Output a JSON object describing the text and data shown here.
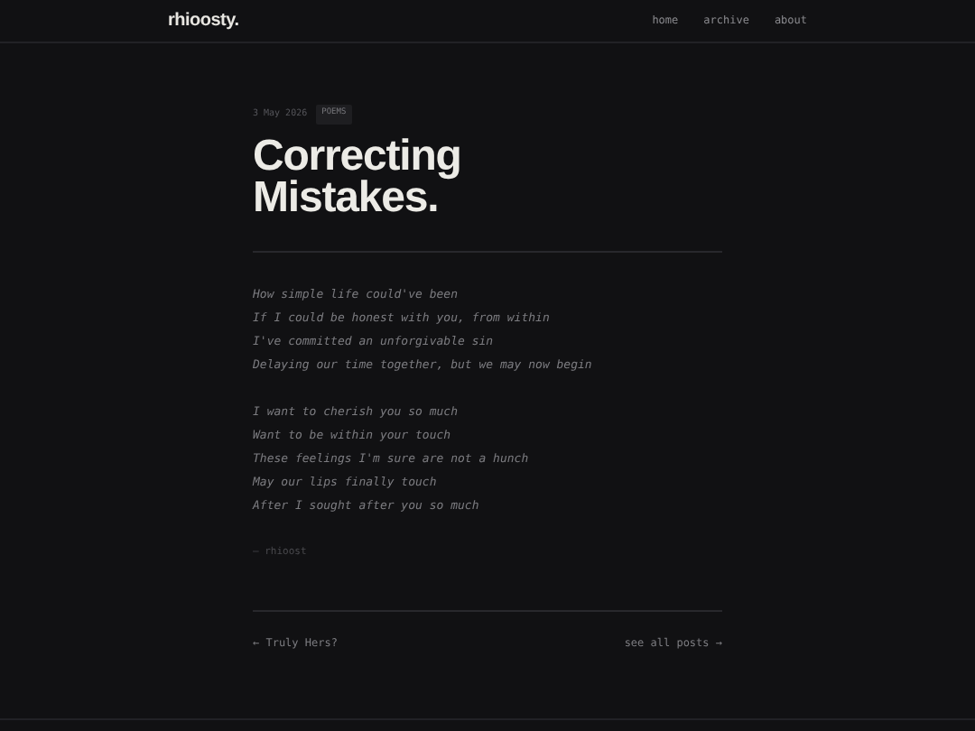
{
  "header": {
    "logo": "rhioosty.",
    "nav": [
      "home",
      "archive",
      "about"
    ]
  },
  "post": {
    "date": "3 May 2026",
    "tag": "POEMS",
    "title_lines": [
      "Correcting",
      "Mistakes."
    ],
    "stanzas": [
      [
        "How simple life could've been",
        "If I could be honest with you, from within",
        "I've committed an unforgivable sin",
        "Delaying our time together, but we may now begin"
      ],
      [
        "I want to cherish you so much",
        "Want to be within your touch",
        "These feelings I'm sure are not a hunch",
        "May our lips finally touch",
        "After I sought after you so much"
      ]
    ],
    "signature": "— rhioost"
  },
  "post_nav": {
    "previous": "← Truly Hers?",
    "all": "see all posts →"
  }
}
